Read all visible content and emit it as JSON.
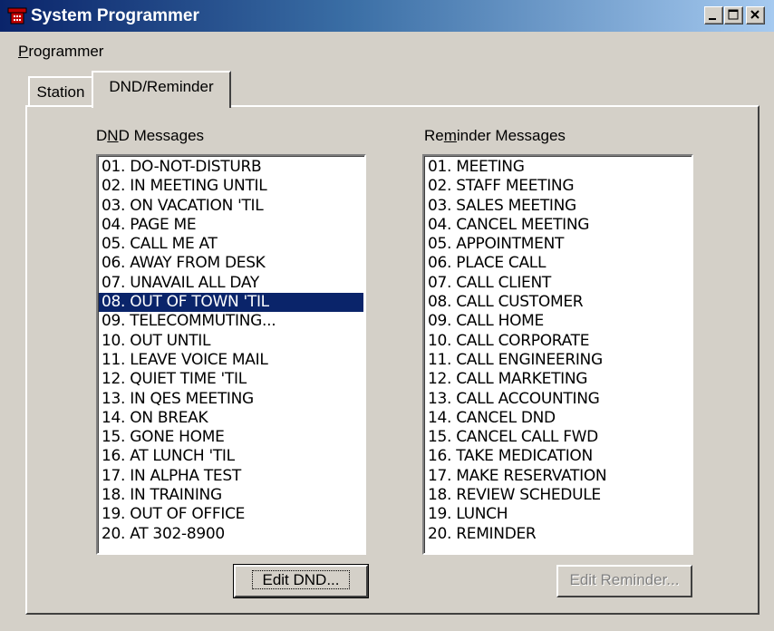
{
  "window": {
    "title": "System Programmer",
    "controls": {
      "minimize": "minimize-icon",
      "maximize": "maximize-icon",
      "close": "close-icon"
    }
  },
  "menubar": {
    "items": [
      {
        "label": "Programmer"
      }
    ]
  },
  "tabs": [
    {
      "label": "Station",
      "active": false
    },
    {
      "label": "DND/Reminder",
      "active": true
    }
  ],
  "dnd": {
    "label": "DND Messages",
    "selected_index": 7,
    "items": [
      "01. DO-NOT-DISTURB",
      "02. IN MEETING UNTIL",
      "03. ON VACATION 'TIL",
      "04. PAGE ME",
      "05. CALL ME AT",
      "06. AWAY FROM DESK",
      "07. UNAVAIL ALL DAY",
      "08. OUT OF TOWN 'TIL",
      "09. TELECOMMUTING...",
      "10. OUT UNTIL",
      "11. LEAVE VOICE MAIL",
      "12. QUIET TIME 'TIL",
      "13. IN QES MEETING",
      "14. ON BREAK",
      "15. GONE HOME",
      "16. AT LUNCH 'TIL",
      "17. IN ALPHA TEST",
      "18. IN TRAINING",
      "19. OUT OF OFFICE",
      "20. AT 302-8900"
    ],
    "button": "Edit DND..."
  },
  "reminder": {
    "label": "Reminder Messages",
    "items": [
      "01. MEETING",
      "02. STAFF MEETING",
      "03. SALES MEETING",
      "04. CANCEL MEETING",
      "05. APPOINTMENT",
      "06. PLACE CALL",
      "07. CALL CLIENT",
      "08. CALL CUSTOMER",
      "09. CALL HOME",
      "10. CALL CORPORATE",
      "11. CALL ENGINEERING",
      "12. CALL MARKETING",
      "13. CALL ACCOUNTING",
      "14. CANCEL DND",
      "15. CANCEL CALL FWD",
      "16. TAKE MEDICATION",
      "17. MAKE RESERVATION",
      "18. REVIEW SCHEDULE",
      "19. LUNCH",
      "20. REMINDER"
    ],
    "button": "Edit Reminder..."
  },
  "colors": {
    "selection": "#0a246a",
    "face": "#d4d0c8",
    "title_start": "#0a246a",
    "title_end": "#a6caf0"
  }
}
